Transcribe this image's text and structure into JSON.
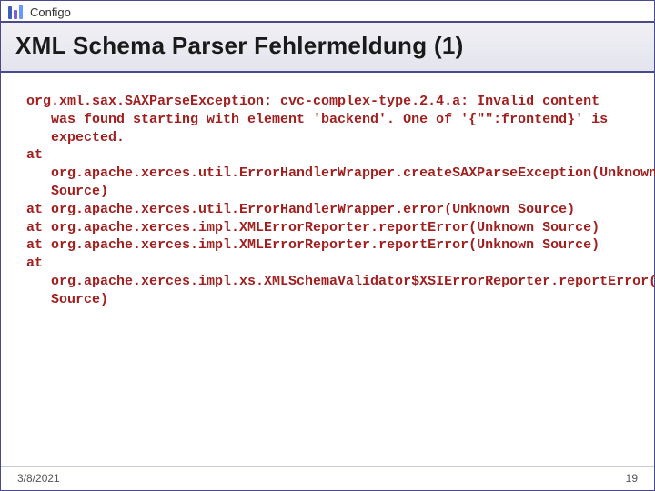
{
  "brand": "Configo",
  "title": "XML Schema Parser Fehlermeldung (1)",
  "error": {
    "firstLine": "org.xml.sax.SAXParseException: cvc-complex-type.2.4.a: Invalid content was found starting with element 'backend'. One of '{\"\":frontend}' is expected.",
    "stack": [
      "at org.apache.xerces.util.ErrorHandlerWrapper.createSAXParseException(Unknown Source)",
      "at org.apache.xerces.util.ErrorHandlerWrapper.error(Unknown Source)",
      "at org.apache.xerces.impl.XMLErrorReporter.reportError(Unknown Source)",
      "at org.apache.xerces.impl.XMLErrorReporter.reportError(Unknown Source)",
      "at org.apache.xerces.impl.xs.XMLSchemaValidator$XSIErrorReporter.reportError(Unknown Source)"
    ]
  },
  "footer": {
    "date": "3/8/2021",
    "page": "19"
  }
}
